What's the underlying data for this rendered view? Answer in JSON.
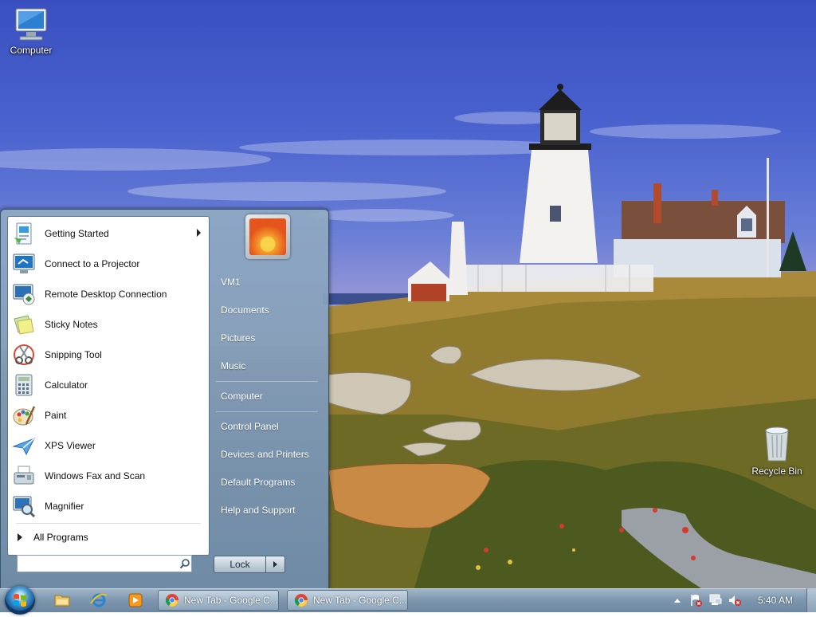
{
  "desktop": {
    "icons": [
      {
        "label": "Computer",
        "icon": "computer-icon"
      },
      {
        "label": "Recycle Bin",
        "icon": "recycle-bin-icon"
      }
    ]
  },
  "start_menu": {
    "programs": [
      {
        "label": "Getting Started",
        "icon": "getting-started-icon",
        "has_submenu": true
      },
      {
        "label": "Connect to a Projector",
        "icon": "projector-icon"
      },
      {
        "label": "Remote Desktop Connection",
        "icon": "remote-desktop-icon"
      },
      {
        "label": "Sticky Notes",
        "icon": "sticky-notes-icon"
      },
      {
        "label": "Snipping Tool",
        "icon": "snipping-tool-icon"
      },
      {
        "label": "Calculator",
        "icon": "calculator-icon"
      },
      {
        "label": "Paint",
        "icon": "paint-icon"
      },
      {
        "label": "XPS Viewer",
        "icon": "xps-viewer-icon"
      },
      {
        "label": "Windows Fax and Scan",
        "icon": "fax-scan-icon"
      },
      {
        "label": "Magnifier",
        "icon": "magnifier-icon"
      }
    ],
    "all_programs": "All Programs",
    "search": {
      "value": "",
      "placeholder": ""
    },
    "right_items": [
      {
        "label": "VM1"
      },
      {
        "label": "Documents"
      },
      {
        "label": "Pictures"
      },
      {
        "label": "Music"
      },
      {
        "label": "Computer"
      },
      {
        "label": "Control Panel"
      },
      {
        "label": "Devices and Printers"
      },
      {
        "label": "Default Programs"
      },
      {
        "label": "Help and Support"
      }
    ],
    "lock_label": "Lock"
  },
  "taskbar": {
    "pinned": [
      {
        "icon": "file-explorer-icon"
      },
      {
        "icon": "internet-explorer-icon"
      },
      {
        "icon": "media-player-icon"
      }
    ],
    "tasks": [
      {
        "label": "New Tab - Google C...",
        "icon": "chrome-icon"
      },
      {
        "label": "New Tab - Google C...",
        "icon": "chrome-icon"
      }
    ],
    "tray_icons": [
      "show-hidden-icons-icon",
      "action-center-flag-icon",
      "network-icon",
      "volume-muted-icon"
    ],
    "clock": "5:40 AM"
  },
  "colors": {
    "taskbar": "#7f98b0",
    "start_menu_right": "#8ea7bf",
    "sky": "#4a63cf"
  }
}
